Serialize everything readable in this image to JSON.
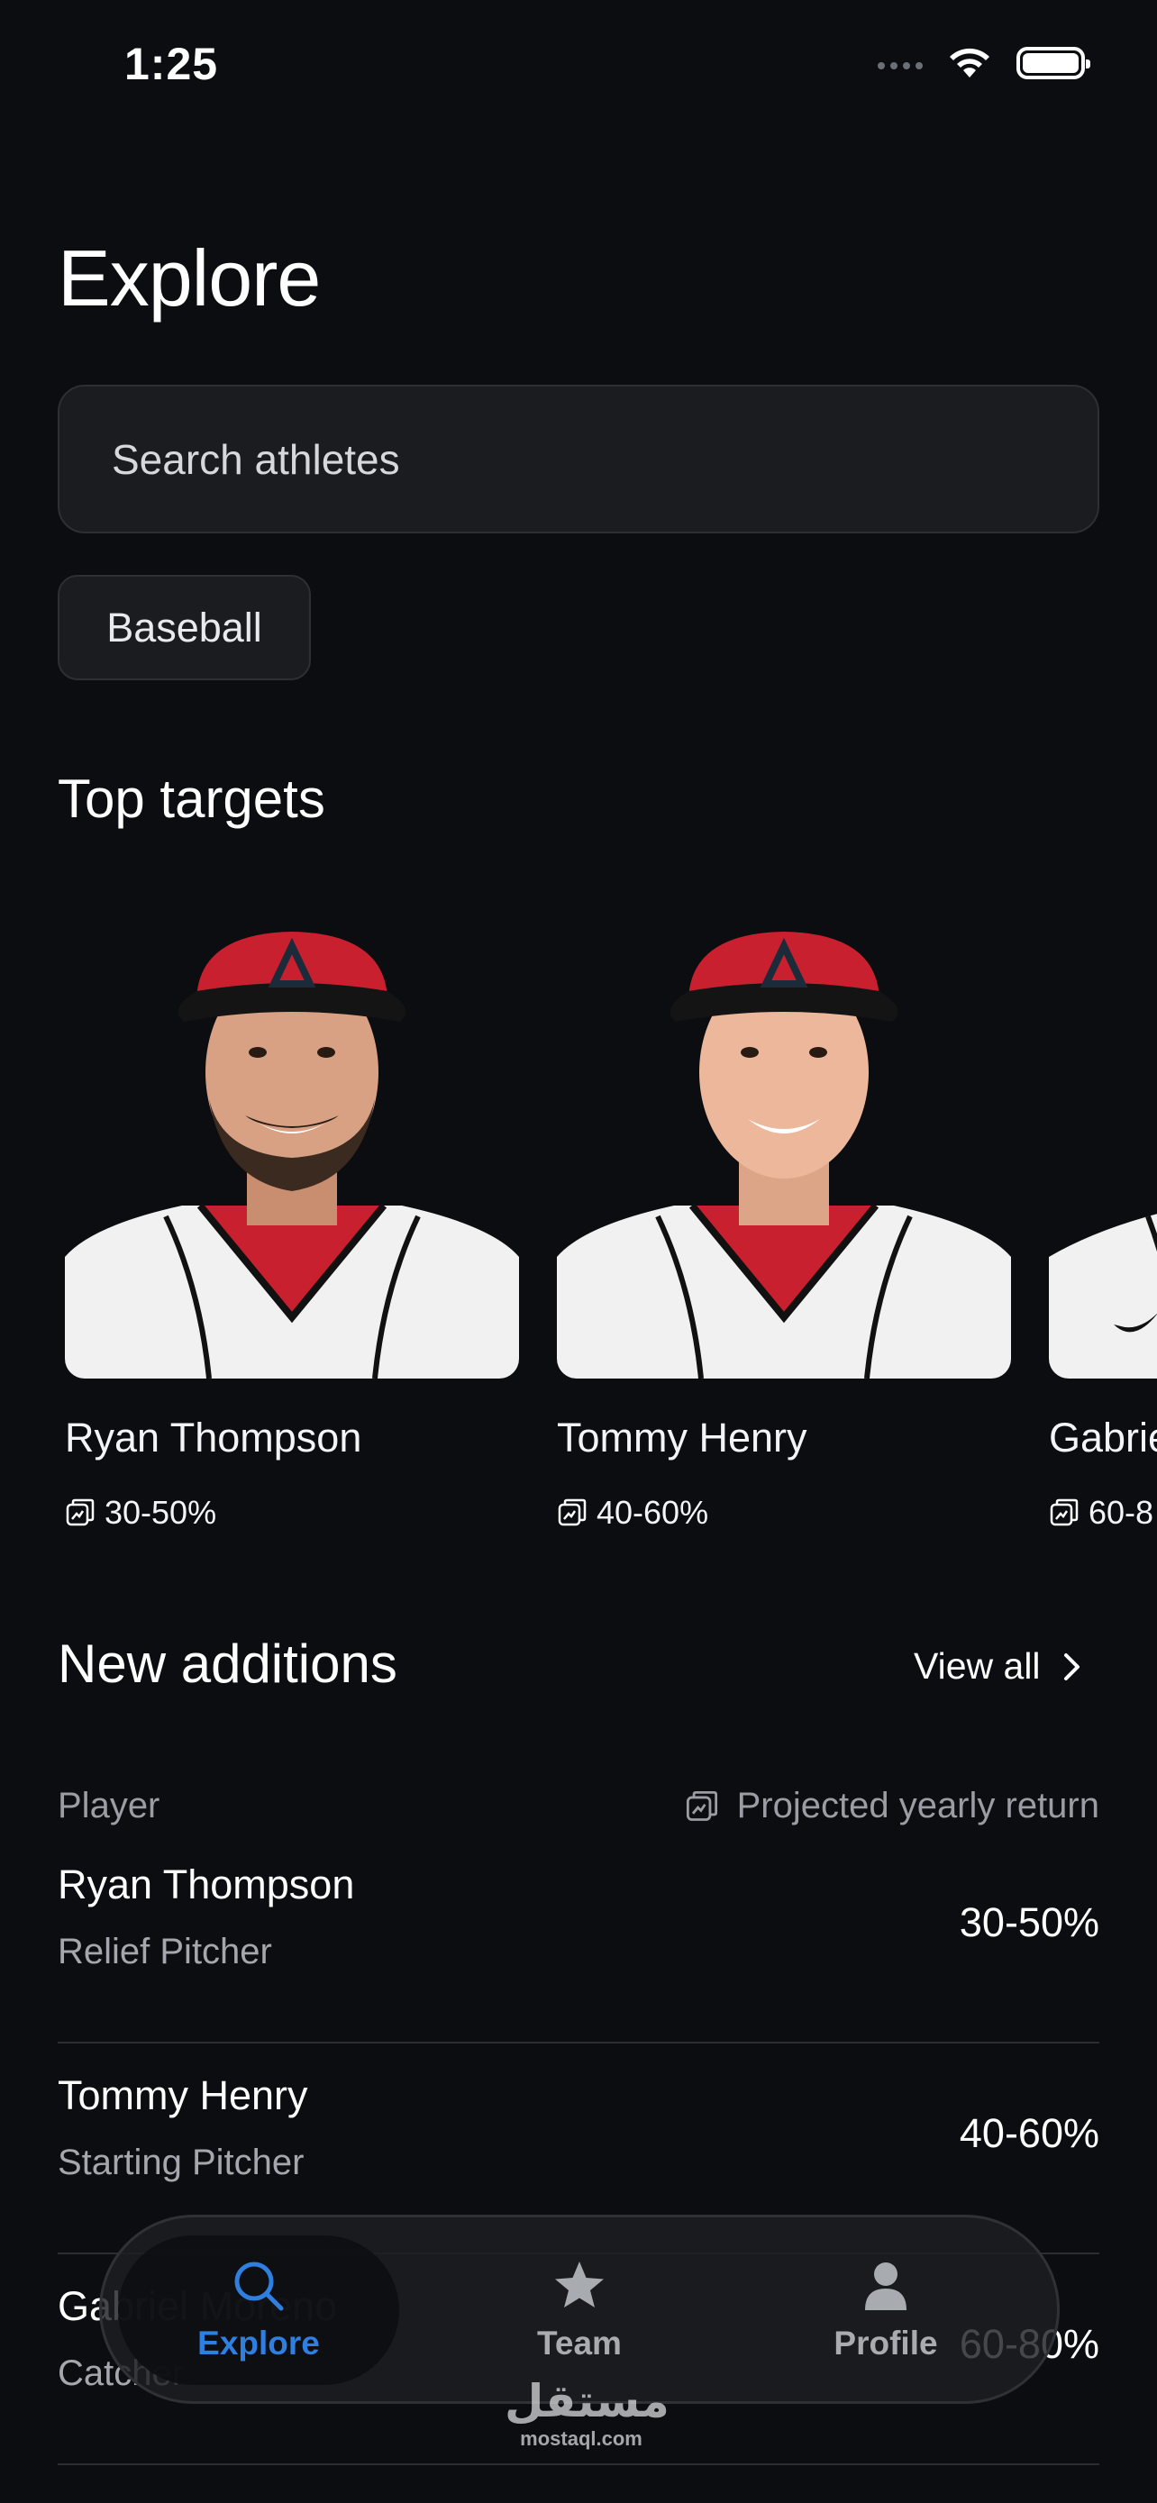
{
  "status": {
    "time": "1:25"
  },
  "page": {
    "title": "Explore"
  },
  "search": {
    "placeholder": "Search athletes"
  },
  "filters": {
    "chip": "Baseball"
  },
  "top_targets": {
    "title": "Top targets",
    "cards": [
      {
        "name": "Ryan Thompson",
        "return": "30-50%"
      },
      {
        "name": "Tommy Henry",
        "return": "40-60%"
      },
      {
        "name": "Gabrie",
        "return": "60-8"
      }
    ]
  },
  "new_additions": {
    "title": "New additions",
    "view_all": "View all",
    "col_player": "Player",
    "col_return": "Projected yearly return",
    "rows": [
      {
        "name": "Ryan Thompson",
        "role": "Relief Pitcher",
        "value": "30-50%"
      },
      {
        "name": "Tommy Henry",
        "role": "Starting Pitcher",
        "value": "40-60%"
      },
      {
        "name": "Gabriel Moreno",
        "role": "Catcher",
        "value": "60-80%"
      }
    ]
  },
  "tabbar": {
    "explore": "Explore",
    "team": "Team",
    "profile": "Profile"
  },
  "watermark": {
    "arabic": "مستقل",
    "latin": "mostaql.com"
  },
  "colors": {
    "background": "#0b0d10",
    "accent": "#2f7fe0",
    "cap_red": "#c8202e"
  }
}
